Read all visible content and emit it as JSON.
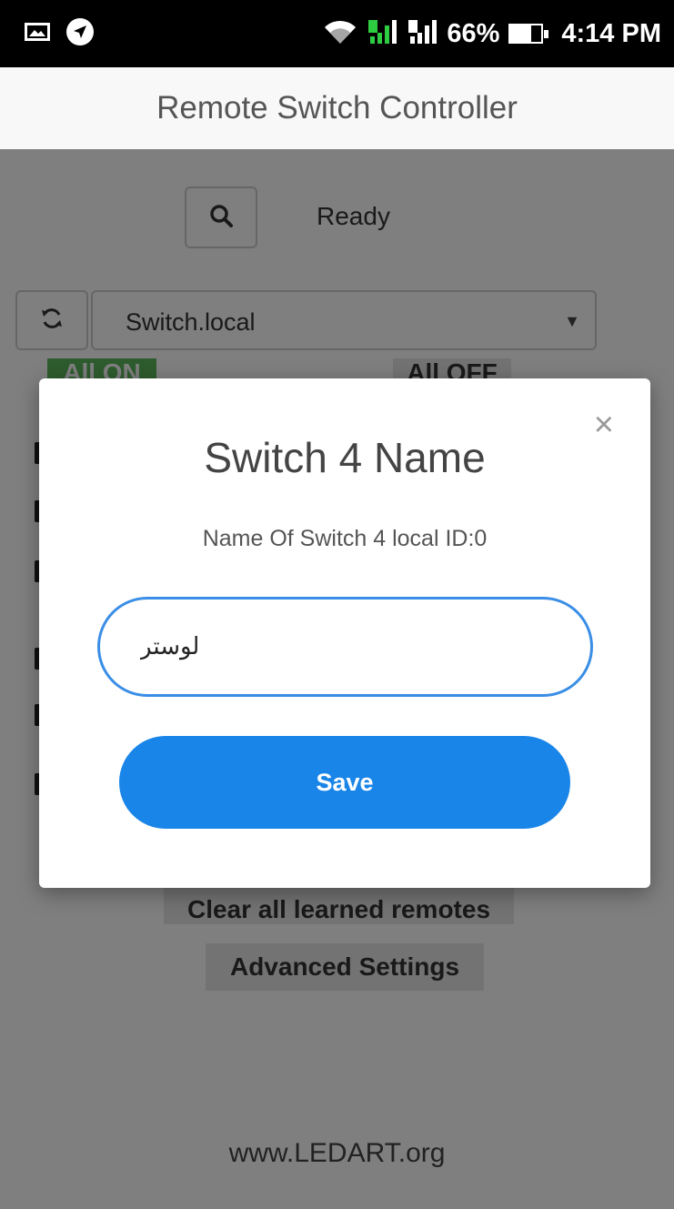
{
  "status_bar": {
    "icons": [
      "image-icon",
      "navigation-icon",
      "wifi-icon",
      "sim1-signal-icon",
      "sim2-signal-icon",
      "battery-icon"
    ],
    "battery": "66%",
    "time": "4:14 PM"
  },
  "app": {
    "title": "Remote Switch Controller"
  },
  "page": {
    "status": "Ready",
    "device_select": {
      "value": "Switch.local"
    },
    "all_on": "All ON",
    "all_off": "All OFF",
    "clear_remotes": "Clear all learned remotes",
    "advanced_settings": "Advanced Settings",
    "footer": "www.LEDART.org"
  },
  "modal": {
    "title": "Switch 4 Name",
    "subtitle": "Name Of Switch 4 local ID:0",
    "name_value": "لوستر",
    "save_label": "Save",
    "close_symbol": "×"
  },
  "colors": {
    "primary": "#1a85e8",
    "input_border": "#3a8ee6",
    "all_on": "#5cb85c",
    "overlay": "rgba(0,0,0,0.5)"
  }
}
